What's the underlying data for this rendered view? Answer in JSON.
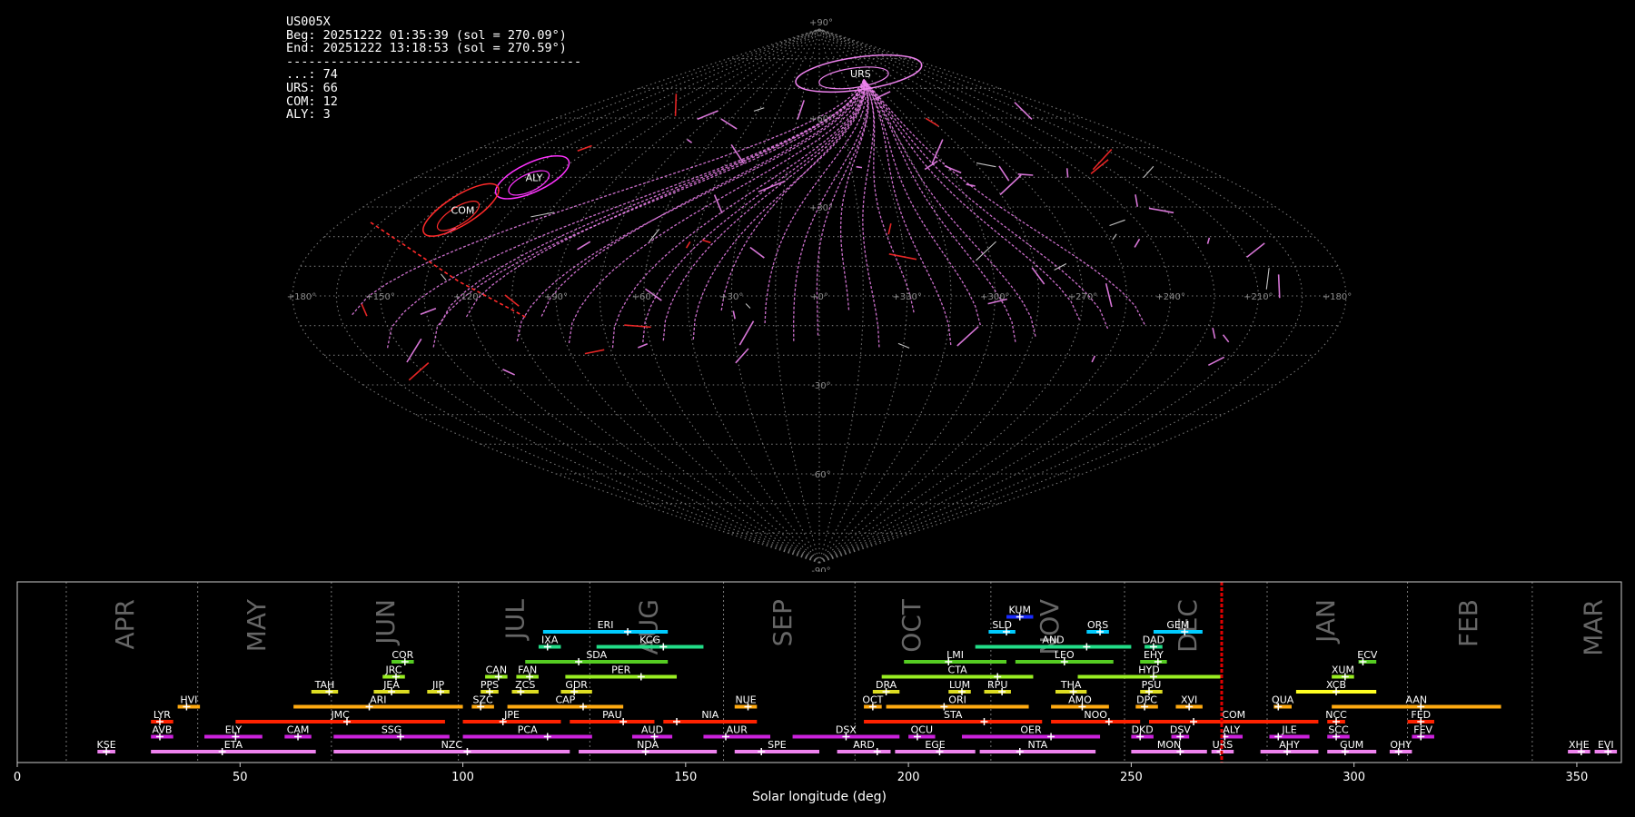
{
  "info": {
    "station": "US005X",
    "begin": "Beg: 20251222 01:35:39 (sol = 270.09°)",
    "end": "End: 20251222 13:18:53 (sol = 270.59°)",
    "separator": "----------------------------------------",
    "counts": [
      "...: 74",
      "URS: 66",
      "COM: 12",
      "ALY: 3"
    ]
  },
  "sky": {
    "lon_labels": [
      {
        "lon": 180,
        "label": "+180°"
      },
      {
        "lon": 150,
        "label": "+150°"
      },
      {
        "lon": 120,
        "label": "+120°"
      },
      {
        "lon": 90,
        "label": "+90°"
      },
      {
        "lon": 60,
        "label": "+60°"
      },
      {
        "lon": 30,
        "label": "+30°"
      },
      {
        "lon": 0,
        "label": "+0°"
      },
      {
        "lon": -30,
        "label": "+330°"
      },
      {
        "lon": -60,
        "label": "+300°"
      },
      {
        "lon": -90,
        "label": "+270°"
      },
      {
        "lon": -120,
        "label": "+240°"
      },
      {
        "lon": -150,
        "label": "+210°"
      },
      {
        "lon": -180,
        "label": "+180°"
      }
    ],
    "lat_labels": [
      {
        "lat": 90,
        "label": "+90°"
      },
      {
        "lat": 60,
        "label": "+60°"
      },
      {
        "lat": 30,
        "label": "+30°"
      },
      {
        "lat": -30,
        "label": "-30°"
      },
      {
        "lat": -60,
        "label": "-60°"
      },
      {
        "lat": -90,
        "label": "-90°"
      }
    ],
    "showers": [
      {
        "code": "URS",
        "lon": -52,
        "lat": 75,
        "ang": -8
      },
      {
        "code": "ALY",
        "lon": 128,
        "lat": 40,
        "ang": -25
      },
      {
        "code": "COM",
        "lon": 140,
        "lat": 29,
        "ang": -32
      }
    ],
    "colors": {
      "urs": "#ee82ee",
      "com": "#ff2a2a",
      "aly": "#ff33ff",
      "sporadic": "#d9d9d9",
      "grid": "#777777"
    }
  },
  "chart_data": {
    "type": "timeline",
    "xlabel": "Solar longitude (deg)",
    "xlim": [
      0,
      360
    ],
    "xticks": [
      0,
      50,
      100,
      150,
      200,
      250,
      300,
      350
    ],
    "current_sol": 270.3,
    "months": [
      {
        "name": "APR",
        "start": 11.0,
        "mid": 24.5
      },
      {
        "name": "MAY",
        "start": 40.5,
        "mid": 54
      },
      {
        "name": "JUN",
        "start": 70.5,
        "mid": 83
      },
      {
        "name": "JUL",
        "start": 99.0,
        "mid": 112
      },
      {
        "name": "AUG",
        "start": 128.5,
        "mid": 142
      },
      {
        "name": "SEP",
        "start": 158.5,
        "mid": 172
      },
      {
        "name": "OCT",
        "start": 188.0,
        "mid": 201
      },
      {
        "name": "NOV",
        "start": 218.5,
        "mid": 232
      },
      {
        "name": "DEC",
        "start": 248.5,
        "mid": 263
      },
      {
        "name": "JAN",
        "start": 280.5,
        "mid": 294
      },
      {
        "name": "FEB",
        "start": 312.0,
        "mid": 326
      },
      {
        "name": "MAR",
        "start": 340.0,
        "mid": 354
      }
    ],
    "showers": [
      {
        "code": "KUM",
        "start": 222,
        "end": 228,
        "peak": 225,
        "row": 9,
        "color": "#1a2bff"
      },
      {
        "code": "ERI",
        "start": 118,
        "end": 146,
        "peak": 137,
        "row": 8,
        "color": "#00ccff"
      },
      {
        "code": "SLD",
        "start": 218,
        "end": 224,
        "peak": 222,
        "row": 8,
        "color": "#00ccff"
      },
      {
        "code": "ORS",
        "start": 240,
        "end": 245,
        "peak": 243,
        "row": 8,
        "color": "#00ccff"
      },
      {
        "code": "GEM",
        "start": 255,
        "end": 266,
        "peak": 262,
        "row": 8,
        "color": "#00ccff"
      },
      {
        "code": "IXA",
        "start": 117,
        "end": 122,
        "peak": 119,
        "row": 7,
        "color": "#22dd88"
      },
      {
        "code": "KCG",
        "start": 130,
        "end": 154,
        "peak": 145,
        "row": 7,
        "color": "#22dd88"
      },
      {
        "code": "AND",
        "start": 215,
        "end": 250,
        "peak": 240,
        "row": 7,
        "color": "#22dd88"
      },
      {
        "code": "DAD",
        "start": 253,
        "end": 257,
        "peak": 255,
        "row": 7,
        "color": "#22dd88"
      },
      {
        "code": "COR",
        "start": 84,
        "end": 89,
        "peak": 87,
        "row": 6,
        "color": "#55cc22"
      },
      {
        "code": "SDA",
        "start": 114,
        "end": 146,
        "peak": 126,
        "row": 6,
        "color": "#55cc22"
      },
      {
        "code": "LMI",
        "start": 199,
        "end": 222,
        "peak": 209,
        "row": 6,
        "color": "#55cc22"
      },
      {
        "code": "LEO",
        "start": 224,
        "end": 246,
        "peak": 235,
        "row": 6,
        "color": "#55cc22"
      },
      {
        "code": "EHY",
        "start": 252,
        "end": 258,
        "peak": 256,
        "row": 6,
        "color": "#55cc22"
      },
      {
        "code": "ECV",
        "start": 301,
        "end": 305,
        "peak": 302,
        "row": 6,
        "color": "#55cc22"
      },
      {
        "code": "JRC",
        "start": 82,
        "end": 87,
        "peak": 85,
        "row": 5,
        "color": "#99ee22"
      },
      {
        "code": "CAN",
        "start": 105,
        "end": 110,
        "peak": 108,
        "row": 5,
        "color": "#99ee22"
      },
      {
        "code": "FAN",
        "start": 112,
        "end": 117,
        "peak": 115,
        "row": 5,
        "color": "#99ee22"
      },
      {
        "code": "PER",
        "start": 123,
        "end": 148,
        "peak": 140,
        "row": 5,
        "color": "#99ee22"
      },
      {
        "code": "CTA",
        "start": 194,
        "end": 228,
        "peak": 220,
        "row": 5,
        "color": "#99ee22"
      },
      {
        "code": "HYD",
        "start": 238,
        "end": 270,
        "peak": 255,
        "row": 5,
        "color": "#99ee22"
      },
      {
        "code": "XUM",
        "start": 295,
        "end": 300,
        "peak": 298,
        "row": 5,
        "color": "#99ee22"
      },
      {
        "code": "TAH",
        "start": 66,
        "end": 72,
        "peak": 70,
        "row": 4,
        "color": "#dddd22"
      },
      {
        "code": "JEA",
        "start": 80,
        "end": 88,
        "peak": 84,
        "row": 4,
        "color": "#dddd22"
      },
      {
        "code": "JIP",
        "start": 92,
        "end": 97,
        "peak": 95,
        "row": 4,
        "color": "#dddd22"
      },
      {
        "code": "PPS",
        "start": 104,
        "end": 108,
        "peak": 106,
        "row": 4,
        "color": "#dddd22"
      },
      {
        "code": "ZCS",
        "start": 111,
        "end": 117,
        "peak": 113,
        "row": 4,
        "color": "#dddd22"
      },
      {
        "code": "GDR",
        "start": 122,
        "end": 129,
        "peak": 125,
        "row": 4,
        "color": "#dddd22"
      },
      {
        "code": "DRA",
        "start": 192,
        "end": 198,
        "peak": 195,
        "row": 4,
        "color": "#dddd22"
      },
      {
        "code": "LUM",
        "start": 209,
        "end": 214,
        "peak": 212,
        "row": 4,
        "color": "#dddd22"
      },
      {
        "code": "RPU",
        "start": 217,
        "end": 223,
        "peak": 221,
        "row": 4,
        "color": "#dddd22"
      },
      {
        "code": "THA",
        "start": 233,
        "end": 240,
        "peak": 237,
        "row": 4,
        "color": "#dddd22"
      },
      {
        "code": "PSU",
        "start": 252,
        "end": 257,
        "peak": 254,
        "row": 4,
        "color": "#dddd22"
      },
      {
        "code": "XCB",
        "start": 287,
        "end": 305,
        "peak": 296,
        "row": 4,
        "color": "#ffff22"
      },
      {
        "code": "HVI",
        "start": 36,
        "end": 41,
        "peak": 38,
        "row": 3,
        "color": "#ffaa11"
      },
      {
        "code": "ARI",
        "start": 62,
        "end": 100,
        "peak": 79,
        "row": 3,
        "color": "#ffaa11"
      },
      {
        "code": "SZC",
        "start": 102,
        "end": 107,
        "peak": 104,
        "row": 3,
        "color": "#ffaa11"
      },
      {
        "code": "CAP",
        "start": 110,
        "end": 136,
        "peak": 127,
        "row": 3,
        "color": "#ffaa11"
      },
      {
        "code": "NUE",
        "start": 161,
        "end": 166,
        "peak": 164,
        "row": 3,
        "color": "#ffaa11"
      },
      {
        "code": "OCT",
        "start": 190,
        "end": 194,
        "peak": 192,
        "row": 3,
        "color": "#ffaa11"
      },
      {
        "code": "ORI",
        "start": 195,
        "end": 227,
        "peak": 208,
        "row": 3,
        "color": "#ffaa11"
      },
      {
        "code": "AMO",
        "start": 232,
        "end": 245,
        "peak": 239,
        "row": 3,
        "color": "#ffaa11"
      },
      {
        "code": "DPC",
        "start": 251,
        "end": 256,
        "peak": 253,
        "row": 3,
        "color": "#ffaa11"
      },
      {
        "code": "XVI",
        "start": 260,
        "end": 266,
        "peak": 263,
        "row": 3,
        "color": "#ffaa11"
      },
      {
        "code": "QUA",
        "start": 282,
        "end": 286,
        "peak": 283,
        "row": 3,
        "color": "#ffaa11"
      },
      {
        "code": "AAN",
        "start": 295,
        "end": 333,
        "peak": 315,
        "row": 3,
        "color": "#ffaa11"
      },
      {
        "code": "LYR",
        "start": 30,
        "end": 35,
        "peak": 32,
        "row": 2,
        "color": "#ff2200"
      },
      {
        "code": "JMC",
        "start": 49,
        "end": 96,
        "peak": 74,
        "row": 2,
        "color": "#ff2200"
      },
      {
        "code": "JPE",
        "start": 100,
        "end": 122,
        "peak": 109,
        "row": 2,
        "color": "#ff2200"
      },
      {
        "code": "PAU",
        "start": 124,
        "end": 143,
        "peak": 136,
        "row": 2,
        "color": "#ff2200"
      },
      {
        "code": "NIA",
        "start": 145,
        "end": 166,
        "peak": 148,
        "row": 2,
        "color": "#ff2200"
      },
      {
        "code": "STA",
        "start": 190,
        "end": 230,
        "peak": 217,
        "row": 2,
        "color": "#ff2200"
      },
      {
        "code": "NOO",
        "start": 232,
        "end": 252,
        "peak": 245,
        "row": 2,
        "color": "#ff2200"
      },
      {
        "code": "COM",
        "start": 254,
        "end": 292,
        "peak": 264,
        "row": 2,
        "color": "#ff2200"
      },
      {
        "code": "NCC",
        "start": 294,
        "end": 298,
        "peak": 296,
        "row": 2,
        "color": "#ff2200"
      },
      {
        "code": "FED",
        "start": 312,
        "end": 318,
        "peak": 315,
        "row": 2,
        "color": "#ff2200"
      },
      {
        "code": "AVB",
        "start": 30,
        "end": 35,
        "peak": 32,
        "row": 1,
        "color": "#cc22dd"
      },
      {
        "code": "ELY",
        "start": 42,
        "end": 55,
        "peak": 49,
        "row": 1,
        "color": "#cc22dd"
      },
      {
        "code": "CAM",
        "start": 60,
        "end": 66,
        "peak": 63,
        "row": 1,
        "color": "#cc22dd"
      },
      {
        "code": "SSG",
        "start": 71,
        "end": 97,
        "peak": 86,
        "row": 1,
        "color": "#cc22dd"
      },
      {
        "code": "PCA",
        "start": 100,
        "end": 129,
        "peak": 119,
        "row": 1,
        "color": "#cc22dd"
      },
      {
        "code": "AUD",
        "start": 138,
        "end": 147,
        "peak": 143,
        "row": 1,
        "color": "#cc22dd"
      },
      {
        "code": "AUR",
        "start": 154,
        "end": 169,
        "peak": 159,
        "row": 1,
        "color": "#cc22dd"
      },
      {
        "code": "DSX",
        "start": 174,
        "end": 198,
        "peak": 186,
        "row": 1,
        "color": "#cc22dd"
      },
      {
        "code": "OCU",
        "start": 200,
        "end": 206,
        "peak": 202,
        "row": 1,
        "color": "#cc22dd"
      },
      {
        "code": "OER",
        "start": 212,
        "end": 243,
        "peak": 232,
        "row": 1,
        "color": "#cc22dd"
      },
      {
        "code": "DKD",
        "start": 250,
        "end": 255,
        "peak": 252,
        "row": 1,
        "color": "#cc22dd"
      },
      {
        "code": "DSV",
        "start": 259,
        "end": 263,
        "peak": 261,
        "row": 1,
        "color": "#cc22dd"
      },
      {
        "code": "ALY",
        "start": 270,
        "end": 275,
        "peak": 271,
        "row": 1,
        "color": "#cc22dd"
      },
      {
        "code": "JLE",
        "start": 281,
        "end": 290,
        "peak": 283,
        "row": 1,
        "color": "#cc22dd"
      },
      {
        "code": "SCC",
        "start": 294,
        "end": 299,
        "peak": 296,
        "row": 1,
        "color": "#cc22dd"
      },
      {
        "code": "FEV",
        "start": 313,
        "end": 318,
        "peak": 315,
        "row": 1,
        "color": "#cc22dd"
      },
      {
        "code": "KSE",
        "start": 18,
        "end": 22,
        "peak": 20,
        "row": 0,
        "color": "#ee82ee"
      },
      {
        "code": "ETA",
        "start": 30,
        "end": 67,
        "peak": 46,
        "row": 0,
        "color": "#ee82ee"
      },
      {
        "code": "NZC",
        "start": 71,
        "end": 124,
        "peak": 101,
        "row": 0,
        "color": "#ee82ee"
      },
      {
        "code": "NDA",
        "start": 126,
        "end": 157,
        "peak": 141,
        "row": 0,
        "color": "#ee82ee"
      },
      {
        "code": "SPE",
        "start": 161,
        "end": 180,
        "peak": 167,
        "row": 0,
        "color": "#ee82ee"
      },
      {
        "code": "ARD",
        "start": 184,
        "end": 196,
        "peak": 193,
        "row": 0,
        "color": "#ee82ee"
      },
      {
        "code": "EGE",
        "start": 197,
        "end": 215,
        "peak": 207,
        "row": 0,
        "color": "#ee82ee"
      },
      {
        "code": "NTA",
        "start": 216,
        "end": 242,
        "peak": 225,
        "row": 0,
        "color": "#ee82ee"
      },
      {
        "code": "MON",
        "start": 250,
        "end": 267,
        "peak": 261,
        "row": 0,
        "color": "#ee82ee"
      },
      {
        "code": "URS",
        "start": 268,
        "end": 273,
        "peak": 270,
        "row": 0,
        "color": "#ee82ee"
      },
      {
        "code": "AHY",
        "start": 279,
        "end": 292,
        "peak": 285,
        "row": 0,
        "color": "#ee82ee"
      },
      {
        "code": "GUM",
        "start": 294,
        "end": 305,
        "peak": 298,
        "row": 0,
        "color": "#ee82ee"
      },
      {
        "code": "OHY",
        "start": 308,
        "end": 313,
        "peak": 310,
        "row": 0,
        "color": "#ee82ee"
      },
      {
        "code": "XHE",
        "start": 348,
        "end": 353,
        "peak": 351,
        "row": 0,
        "color": "#ee82ee"
      },
      {
        "code": "EVI",
        "start": 354,
        "end": 359,
        "peak": 357,
        "row": 0,
        "color": "#ee82ee"
      }
    ]
  }
}
